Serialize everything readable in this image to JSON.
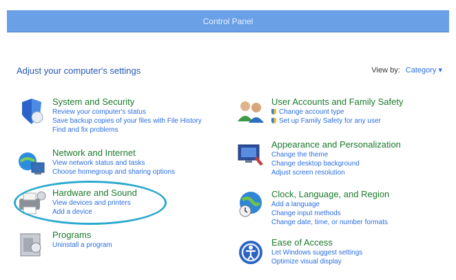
{
  "window": {
    "title": "Control Panel"
  },
  "heading": "Adjust your computer's settings",
  "view_by": {
    "label": "View by:",
    "value": "Category"
  },
  "categories": [
    {
      "title": "System and Security",
      "icon": "shield-icon",
      "links": [
        "Review your computer's status",
        "Save backup copies of your files with File History",
        "Find and fix problems"
      ]
    },
    {
      "title": "Network and Internet",
      "icon": "network-globe-icon",
      "links": [
        "View network status and tasks",
        "Choose homegroup and sharing options"
      ]
    },
    {
      "title": "Hardware and Sound",
      "icon": "printer-icon",
      "links": [
        "View devices and printers",
        "Add a device"
      ]
    },
    {
      "title": "Programs",
      "icon": "programs-icon",
      "links": [
        "Uninstall a program"
      ]
    },
    {
      "title": "User Accounts and Family Safety",
      "icon": "users-icon",
      "links": [
        "Change account type",
        "Set up Family Safety for any user"
      ]
    },
    {
      "title": "Appearance and Personalization",
      "icon": "appearance-icon",
      "links": [
        "Change the theme",
        "Change desktop background",
        "Adjust screen resolution"
      ]
    },
    {
      "title": "Clock, Language, and Region",
      "icon": "clock-globe-icon",
      "links": [
        "Add a language",
        "Change input methods",
        "Change date, time, or number formats"
      ]
    },
    {
      "title": "Ease of Access",
      "icon": "ease-of-access-icon",
      "links": [
        "Let Windows suggest settings",
        "Optimize visual display"
      ]
    }
  ],
  "colors": {
    "titlebar": "#6aa0e6",
    "highlight_ring": "#2aa9cf",
    "link": "#2a6ee0",
    "category_title": "#1a7a2b"
  }
}
